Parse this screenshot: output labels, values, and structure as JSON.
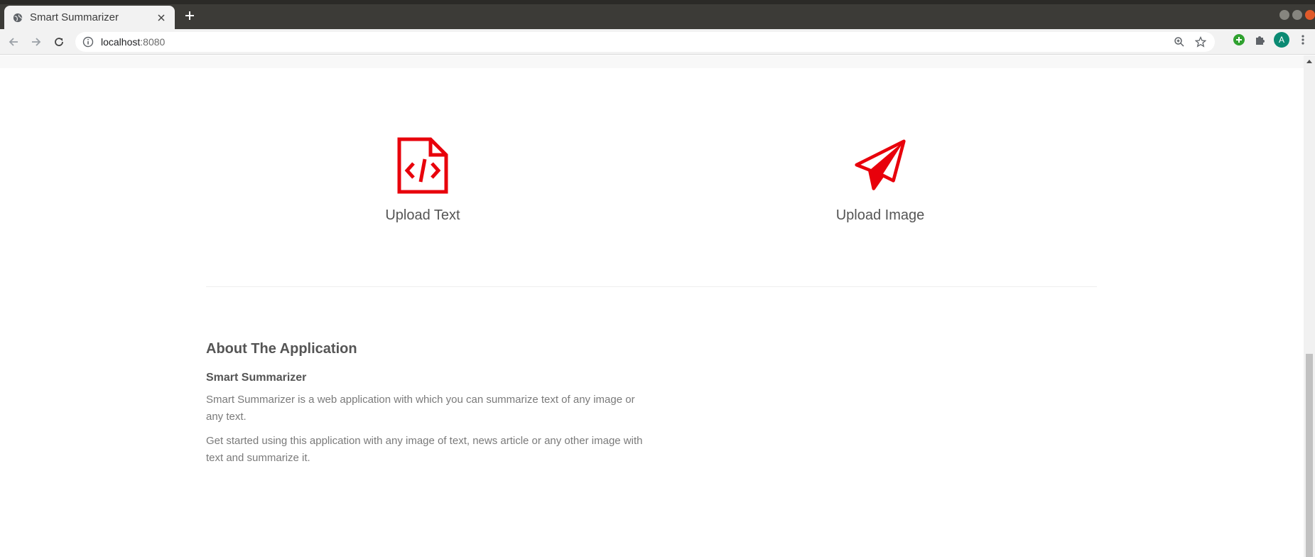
{
  "browser": {
    "tab_title": "Smart Summarizer",
    "url_host": "localhost",
    "url_port": ":8080",
    "avatar_letter": "A"
  },
  "page": {
    "cards": [
      {
        "label": "Upload Text",
        "icon": "file-code-icon"
      },
      {
        "label": "Upload Image",
        "icon": "paper-plane-icon"
      }
    ],
    "about": {
      "heading": "About The Application",
      "subheading": "Smart Summarizer",
      "para1": "Smart Summarizer is a web application with which you can summarize text of any image or any text.",
      "para2": "Get started using this application with any image of text, news article or any other image with text and summarize it."
    }
  },
  "colors": {
    "accent": "#e8000b",
    "text": "#555555",
    "muted": "#7a7a7a"
  }
}
